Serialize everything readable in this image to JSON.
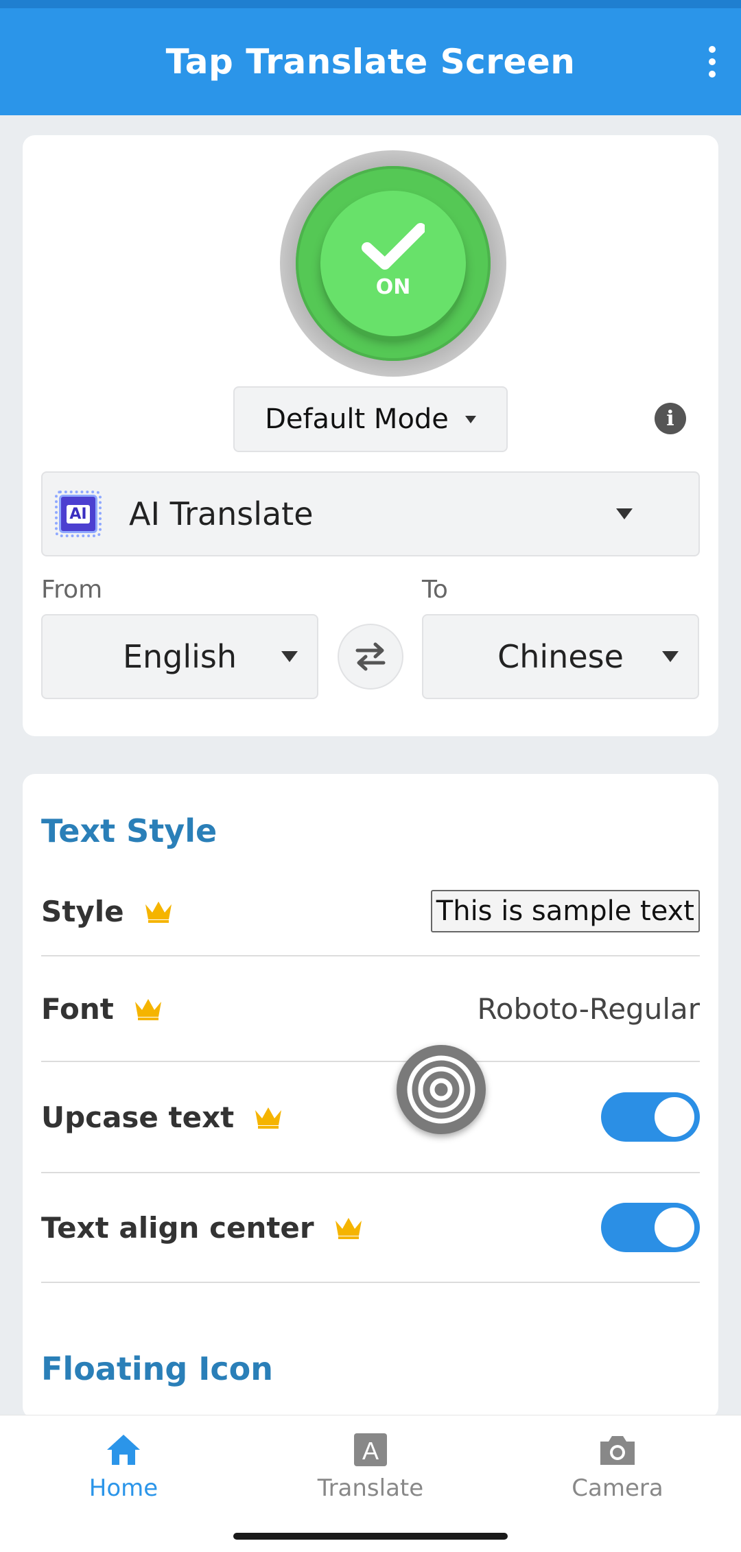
{
  "app_bar": {
    "title": "Tap Translate Screen"
  },
  "power": {
    "label": "ON"
  },
  "mode": {
    "selected": "Default Mode"
  },
  "info": {
    "glyph": "i"
  },
  "engine": {
    "chip_text": "AI",
    "selected": "AI Translate"
  },
  "languages": {
    "from_caption": "From",
    "from_value": "English",
    "to_caption": "To",
    "to_value": "Chinese"
  },
  "text_style": {
    "title": "Text Style",
    "style_label": "Style",
    "style_sample": "This is sample text",
    "font_label": "Font",
    "font_value": "Roboto-Regular",
    "upcase_label": "Upcase text",
    "upcase_on": true,
    "align_label": "Text align center",
    "align_on": true
  },
  "floating_icon": {
    "title": "Floating Icon"
  },
  "bottom_nav": {
    "items": [
      {
        "label": "Home",
        "active": true
      },
      {
        "label": "Translate",
        "active": false
      },
      {
        "label": "Camera",
        "active": false
      }
    ]
  },
  "colors": {
    "app_bar": "#2b95e9",
    "accent_title": "#2a7fb8",
    "power_green": "#68e16a",
    "toggle_on": "#2b8fe5",
    "crown": "#f5b400"
  },
  "icons": {
    "menu": "more-vert-icon",
    "power": "check-icon",
    "info": "info-icon",
    "engine": "ai-chip-icon",
    "swap": "swap-icon",
    "premium": "crown-icon",
    "float": "target-icon",
    "home": "home-icon",
    "translate": "translate-icon",
    "camera": "camera-icon"
  }
}
